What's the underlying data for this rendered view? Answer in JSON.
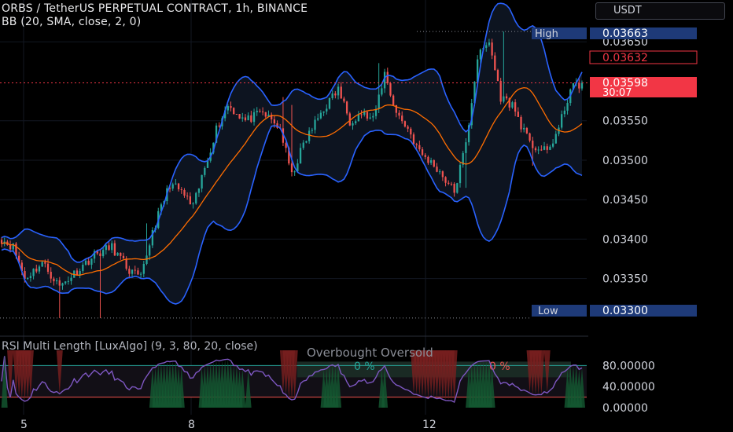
{
  "header": {
    "title": "ORBS / TetherUS PERPETUAL CONTRACT, 1h, BINANCE",
    "indicator": "BB (20, SMA, close, 2, 0)",
    "currency": "USDT"
  },
  "rsi_panel": {
    "title": "RSI Multi Length [LuxAlgo] (9, 3, 80, 20, close)",
    "overbought_label": "Overbought",
    "oversold_label": "Oversold",
    "ob_pct": "0 %",
    "os_pct": "0 %"
  },
  "price_labels": {
    "high_tag": "High",
    "high_value": "0.03663",
    "low_tag": "Low",
    "low_value": "0.03300",
    "upper_band_value": "0.03632",
    "last_price": "0.03598",
    "countdown": "30:07"
  },
  "colors": {
    "up": "#26a69a",
    "down": "#ef5350",
    "bb_band": "#2962ff",
    "bb_basis": "#ff6d00",
    "bb_fill": "#0d1420",
    "rsi_line": "#7e57c2",
    "tag_blue": "#1e3a78",
    "last_price_bg": "#f23645"
  },
  "chart_data": [
    {
      "type": "candlestick",
      "title": "ORBS / TetherUS PERPETUAL CONTRACT, 1h, BINANCE",
      "x_ticks": [
        "5",
        "8",
        "12"
      ],
      "y_ticks": [
        "0.03650",
        "0.03550",
        "0.03500",
        "0.03450",
        "0.03400",
        "0.03350"
      ],
      "ylim": [
        0.03285,
        0.03693
      ],
      "anchors": {
        "x": [
          0,
          4,
          8,
          14,
          20,
          26,
          32,
          38,
          44,
          48,
          52,
          58,
          62,
          66,
          70,
          74,
          78,
          84,
          90,
          96,
          100,
          104,
          110,
          116,
          120,
          124,
          128,
          132,
          136,
          140,
          144,
          150,
          156,
          160,
          164,
          168,
          172,
          176,
          182,
          188,
          192,
          196,
          200
        ],
        "close": [
          0.034,
          0.0339,
          0.0335,
          0.0337,
          0.0334,
          0.0336,
          0.0338,
          0.0339,
          0.0336,
          0.0335,
          0.0341,
          0.0347,
          0.0346,
          0.0344,
          0.0349,
          0.0354,
          0.0357,
          0.0355,
          0.0356,
          0.0354,
          0.0348,
          0.0352,
          0.0356,
          0.0359,
          0.0355,
          0.0356,
          0.0355,
          0.0361,
          0.0356,
          0.0354,
          0.0351,
          0.0349,
          0.0346,
          0.0352,
          0.0363,
          0.0365,
          0.0358,
          0.0357,
          0.0352,
          0.0351,
          0.0354,
          0.0359,
          0.03598
        ]
      },
      "candle_count": 201,
      "bollinger": {
        "period": 20,
        "stddev": 2
      },
      "high_value": 0.03663,
      "low_value": 0.033,
      "last_close": 0.03598,
      "upper_band_last": 0.03632
    },
    {
      "type": "line",
      "title": "RSI Multi Length [LuxAlgo] (9, 3, 80, 20, close)",
      "y_ticks": [
        "80.00000",
        "40.00000",
        "0.00000"
      ],
      "ylim": [
        0,
        100
      ],
      "overbought": 80,
      "oversold": 20
    }
  ]
}
